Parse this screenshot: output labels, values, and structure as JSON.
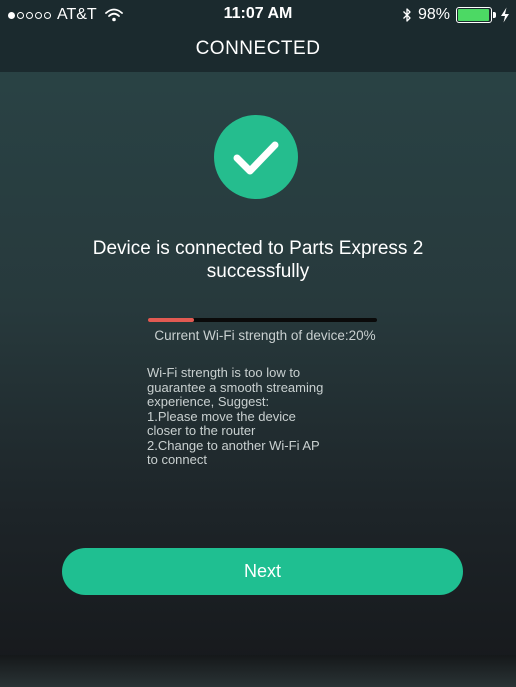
{
  "status_bar": {
    "carrier": "AT&T",
    "time": "11:07 AM",
    "battery_percent_text": "98%",
    "battery_level": 0.98,
    "signal_bars_filled": 1,
    "signal_bars_total": 5
  },
  "header": {
    "title": "CONNECTED"
  },
  "main": {
    "success_icon": "checkmark-icon",
    "message": "Device is connected to Parts Express 2 successfully",
    "wifi_strength": {
      "label": "Current Wi-Fi strength of device:20%",
      "value_percent": 20
    },
    "advice_lines": [
      "Wi-Fi strength is too low to",
      "guarantee a smooth streaming",
      "experience,  Suggest:",
      "1.Please move the device",
      "closer to the router",
      "2.Change to another Wi-Fi AP",
      "to connect"
    ],
    "next_button_label": "Next"
  },
  "colors": {
    "accent": "#1fbf91",
    "strength_low": "#e25a52",
    "battery": "#4cd964"
  }
}
